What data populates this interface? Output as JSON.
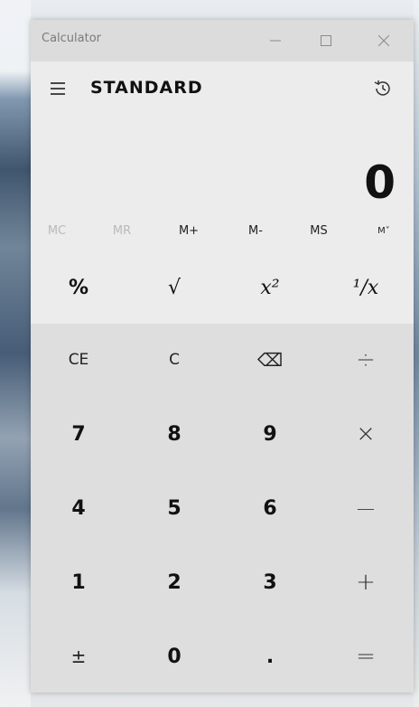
{
  "window": {
    "title": "Calculator"
  },
  "titlebar": {
    "min_glyph": "—",
    "max_glyph": "□",
    "close_glyph": "✕"
  },
  "header": {
    "mode": "STANDARD",
    "menu_icon": "hamburger-menu-icon",
    "history_icon": "history-icon"
  },
  "display": {
    "value": "0"
  },
  "memory": {
    "mc": "MC",
    "mr": "MR",
    "mplus": "M+",
    "mminus": "M-",
    "ms": "MS",
    "mlist": "M˅"
  },
  "keys": {
    "percent": "%",
    "sqrt": "√",
    "square": "x²",
    "reciprocal": "¹/x",
    "ce": "CE",
    "c": "C",
    "backspace": "⌫",
    "divide": "÷",
    "seven": "7",
    "eight": "8",
    "nine": "9",
    "multiply": "×",
    "four": "4",
    "five": "5",
    "six": "6",
    "minus": "—",
    "one": "1",
    "two": "2",
    "three": "3",
    "plus": "+",
    "negate": "±",
    "zero": "0",
    "decimal": ".",
    "equals": "="
  }
}
